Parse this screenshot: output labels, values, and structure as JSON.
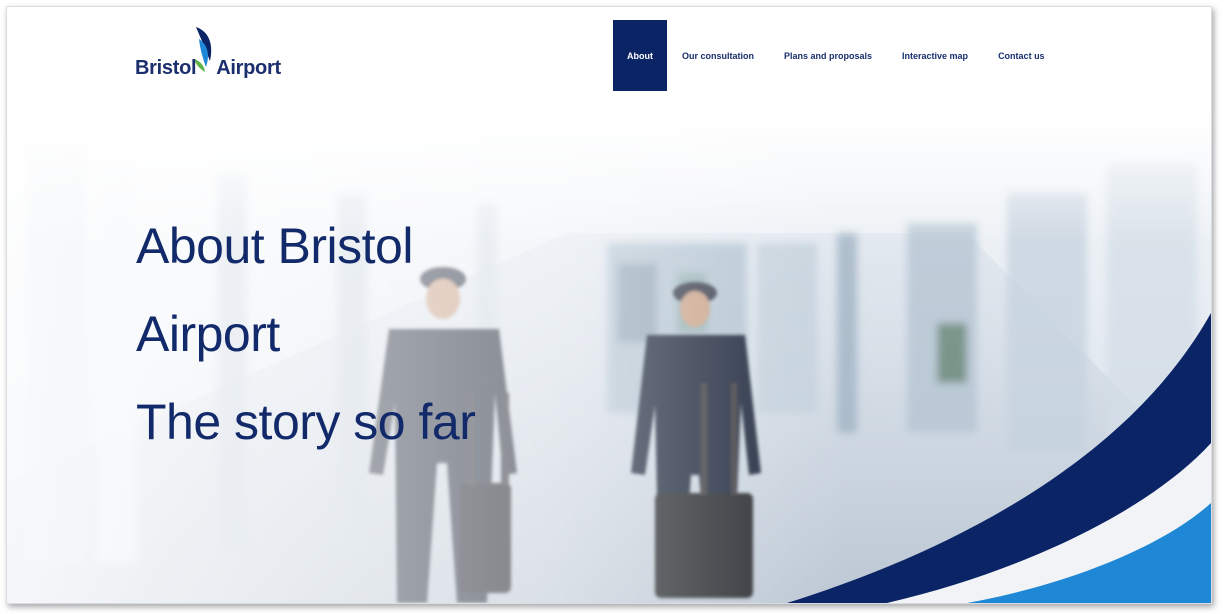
{
  "brand": {
    "name_part1": "Bristol",
    "name_part2": "Airport",
    "logo_icon": "sail-wing-icon",
    "color_navy": "#0b2466",
    "color_blue": "#1e88d6"
  },
  "nav": {
    "items": [
      {
        "label": "About",
        "active": true
      },
      {
        "label": "Our consultation",
        "active": false
      },
      {
        "label": "Plans and proposals",
        "active": false
      },
      {
        "label": "Interactive map",
        "active": false
      },
      {
        "label": "Contact us",
        "active": false
      }
    ]
  },
  "hero": {
    "line1": "About Bristol",
    "line2": "Airport",
    "line3": "The story so far",
    "image_subject": "pilots-walking-terminal-photo"
  }
}
